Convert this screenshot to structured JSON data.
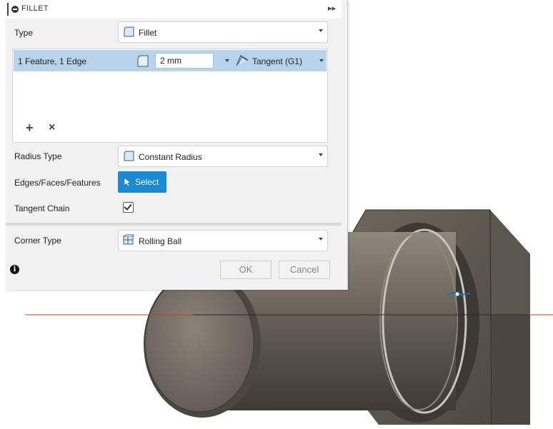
{
  "dialog": {
    "title": "FILLET",
    "expand_glyph": "▸▸",
    "type_label": "Type",
    "type_value": "Fillet",
    "selection_row": {
      "feature": "1 Feature, 1 Edge",
      "radius": "2 mm",
      "continuity": "Tangent (G1)"
    },
    "add_glyph": "+",
    "remove_glyph": "×",
    "radius_type_label": "Radius Type",
    "radius_type_value": "Constant Radius",
    "edges_label": "Edges/Faces/Features",
    "select_label": "Select",
    "tangent_chain_label": "Tangent Chain",
    "tangent_chain_checked": true,
    "corner_type_label": "Corner Type",
    "corner_type_value": "Rolling Ball",
    "info_glyph": "i",
    "ok_label": "OK",
    "cancel_label": "Cancel"
  },
  "colors": {
    "selected_row": "#b8d3ec",
    "select_button": "#1a8ad4",
    "axis_line": "#c0392b",
    "part_body": "#6b655a"
  },
  "icons": [
    "fillet-icon",
    "tangent-icon",
    "constant-radius-icon",
    "cursor-icon",
    "rolling-ball-icon",
    "info-icon",
    "chevron-down-icon"
  ]
}
